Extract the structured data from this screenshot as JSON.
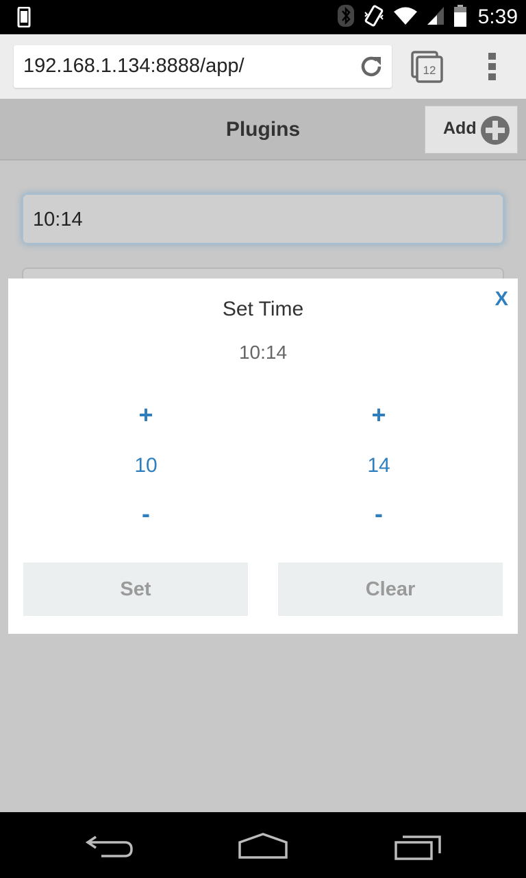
{
  "status_bar": {
    "time": "5:39",
    "icons": [
      "phone-icon",
      "bluetooth-icon",
      "vibrate-icon",
      "wifi-icon",
      "signal-icon",
      "battery-icon"
    ]
  },
  "browser": {
    "url": "192.168.1.134:8888/app/",
    "tab_count": "12"
  },
  "header": {
    "title": "Plugins",
    "add_label": "Add"
  },
  "form": {
    "time_value": "10:14"
  },
  "modal": {
    "close_label": "X",
    "title": "Set Time",
    "current_value": "10:14",
    "hours": {
      "plus": "+",
      "value": "10",
      "minus": "-"
    },
    "minutes": {
      "plus": "+",
      "value": "14",
      "minus": "-"
    },
    "set_label": "Set",
    "clear_label": "Clear"
  },
  "colors": {
    "accent": "#2f7fbf",
    "button_bg": "#eceff0",
    "button_text": "#9a9a9a",
    "page_bg": "#c8c8c8"
  }
}
